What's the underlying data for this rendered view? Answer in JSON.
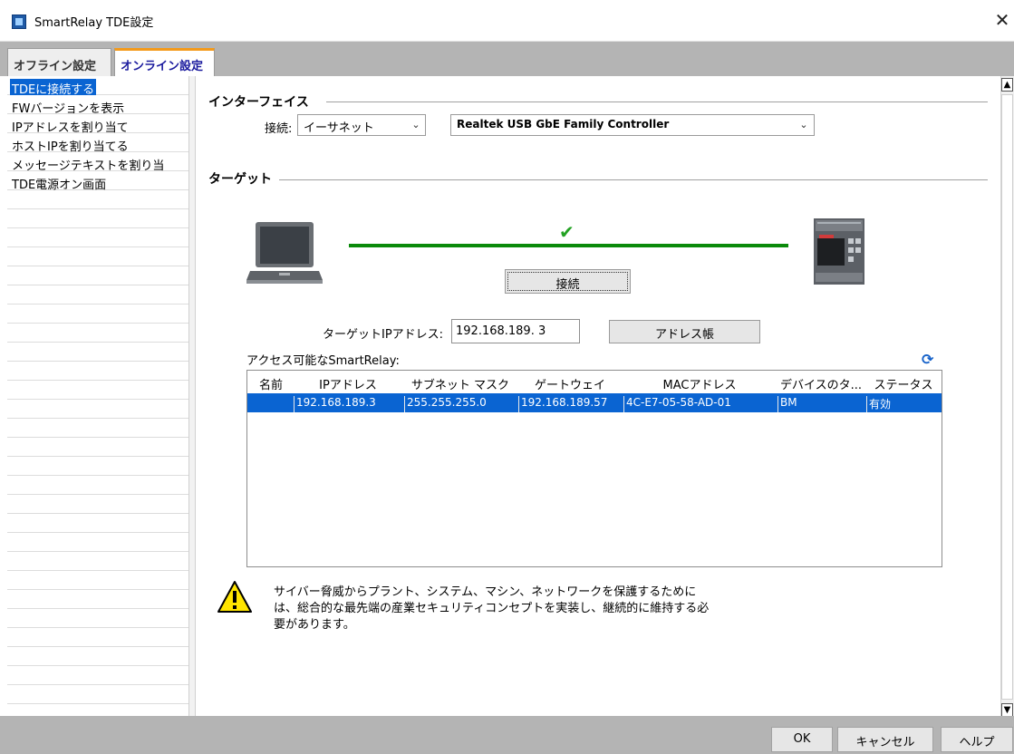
{
  "window": {
    "title": "SmartRelay TDE設定",
    "close_label": "✕"
  },
  "tabs": [
    {
      "label": "オフライン設定"
    },
    {
      "label": "オンライン設定"
    }
  ],
  "nav": {
    "items": [
      {
        "label": "TDEに接続する"
      },
      {
        "label": "FWバージョンを表示"
      },
      {
        "label": "IPアドレスを割り当て"
      },
      {
        "label": "ホストIPを割り当てる"
      },
      {
        "label": "メッセージテキストを割り当"
      },
      {
        "label": "TDE電源オン画面"
      }
    ]
  },
  "interface": {
    "header": "インターフェイス",
    "conn_label": "接続:",
    "conn_value": "イーサネット",
    "adapter_value": "Realtek USB GbE Family Controller"
  },
  "target": {
    "header": "ターゲット",
    "connect_label": "接続",
    "ip_label": "ターゲットIPアドレス:",
    "ip_value": "192.168.189. 3",
    "address_book_label": "アドレス帳",
    "access_label": "アクセス可能なSmartRelay:",
    "check_glyph": "✔",
    "refresh_glyph": "⟳"
  },
  "table": {
    "headers": [
      "名前",
      "IPアドレス",
      "サブネット マスク",
      "ゲートウェイ",
      "MACアドレス",
      "デバイスのタ...",
      "ステータス"
    ],
    "rows": [
      [
        "",
        "192.168.189.3",
        "255.255.255.0",
        "192.168.189.57",
        "4C-E7-05-58-AD-01",
        "BM",
        "有効"
      ]
    ]
  },
  "warning": {
    "lines": [
      "サイバー脅威からプラント、システム、マシン、ネットワークを保護するために",
      "は、総合的な最先端の産業セキュリティコンセプトを実装し、継続的に維持する必",
      "要があります。"
    ]
  },
  "footer": {
    "ok_label": "OK",
    "cancel_label": "キャンセル",
    "help_label": "ヘルプ"
  },
  "scrollbar": {
    "up": "▲",
    "down": "▼"
  },
  "colors": {
    "selection": "#0a64d2",
    "link_ok": "#0b8a0b",
    "tab_accent": "#f49a1a"
  },
  "icons": {
    "app": "app-icon",
    "laptop": "laptop-icon",
    "device": "smartrelay-device-icon",
    "warning": "warning-icon"
  }
}
